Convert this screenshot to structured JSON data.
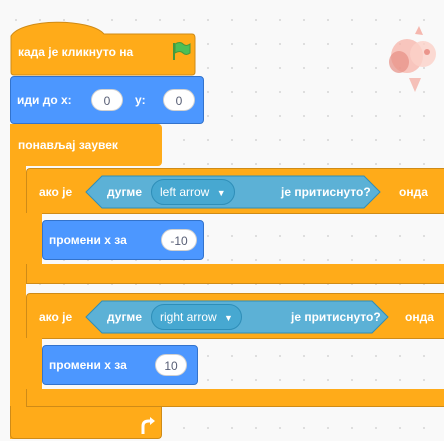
{
  "hat": {
    "text": "када је кликнуто на",
    "flag_icon": "green-flag-icon"
  },
  "goto": {
    "text": "иди до x:",
    "x_value": "0",
    "y_label": "y:",
    "y_value": "0"
  },
  "forever": {
    "text": "понављај заувек",
    "loop_icon": "loop-arrow-icon"
  },
  "if1": {
    "if_text": "ако је",
    "sensing_text": "дугме",
    "key": "left arrow",
    "pressed_text": "је притиснуто?",
    "then_text": "онда",
    "change_text": "промени x за",
    "change_value": "-10"
  },
  "if2": {
    "if_text": "ако је",
    "sensing_text": "дугме",
    "key": "right arrow",
    "pressed_text": "је притиснуто?",
    "then_text": "онда",
    "change_text": "промени x за",
    "change_value": "10"
  },
  "colors": {
    "control": "#ffab19",
    "motion": "#4c97ff",
    "sensing": "#5cb1d6"
  }
}
